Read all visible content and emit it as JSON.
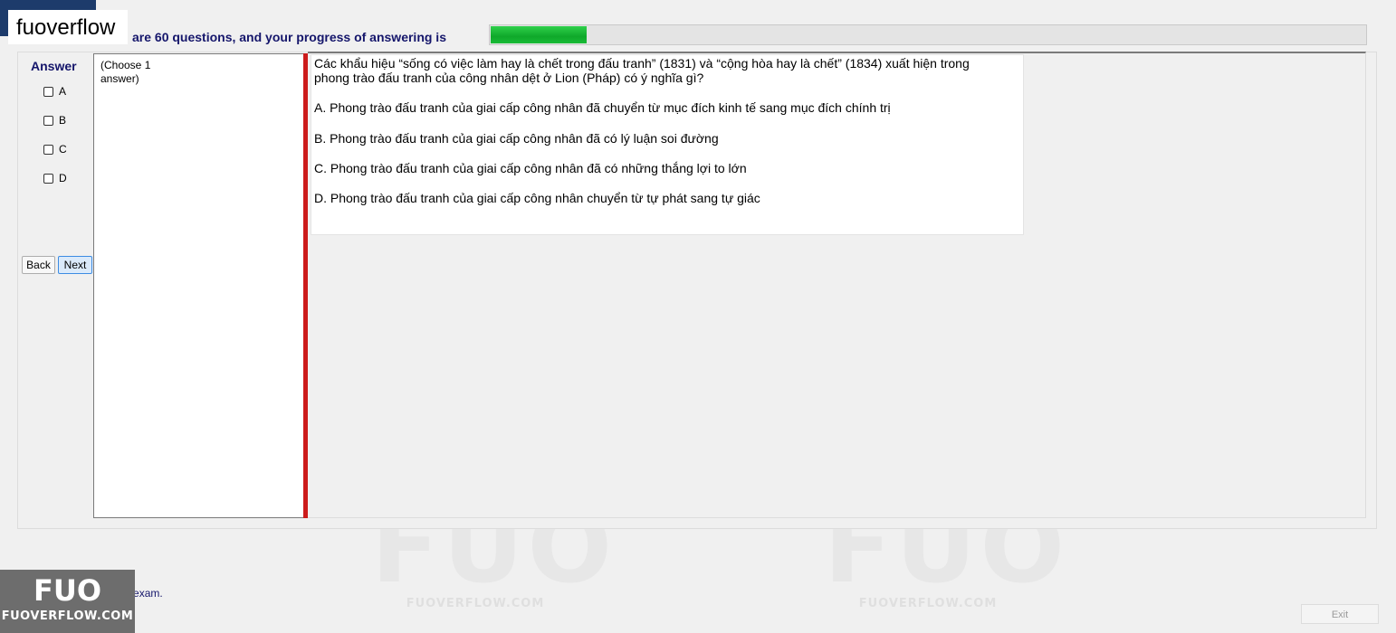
{
  "brand": "fuoverflow",
  "header": {
    "progress_text": "are 60 questions, and your progress of answering is",
    "progress_fraction": 0.11
  },
  "answer_panel": {
    "title": "Answer",
    "options": [
      "A",
      "B",
      "C",
      "D"
    ],
    "back_label": "Back",
    "next_label": "Next"
  },
  "choose_hint": "(Choose 1 answer)",
  "question": {
    "text": "Các khẩu hiệu “sống có việc làm hay là chết trong đấu tranh” (1831) và “cộng hòa hay là chết” (1834) xuất hiện trong phong trào đấu tranh của công nhân dệt ở Lion (Pháp) có ý nghĩa gì?",
    "options": [
      "A.  Phong trào đấu tranh của giai cấp công nhân đã chuyển từ mục đích kinh tế sang mục đích chính trị",
      "B.  Phong trào đấu tranh của giai cấp công nhân đã có lý luận soi đường",
      "C.  Phong trào đấu tranh của giai cấp công nhân đã có những thắng lợi to lớn",
      "D.  Phong trào đấu tranh của giai cấp công nhân chuyển từ tự phát sang tự giác"
    ]
  },
  "footer": {
    "finish_label": "I want to finish the exam.",
    "exit_label": "Exit"
  },
  "watermark": {
    "logo_text": "FUO",
    "site_text": "FUOVERFLOW.COM"
  },
  "colors": {
    "header_text": "#15166b",
    "progress_fill": "#19bb36",
    "separator": "#cc1b1b"
  }
}
